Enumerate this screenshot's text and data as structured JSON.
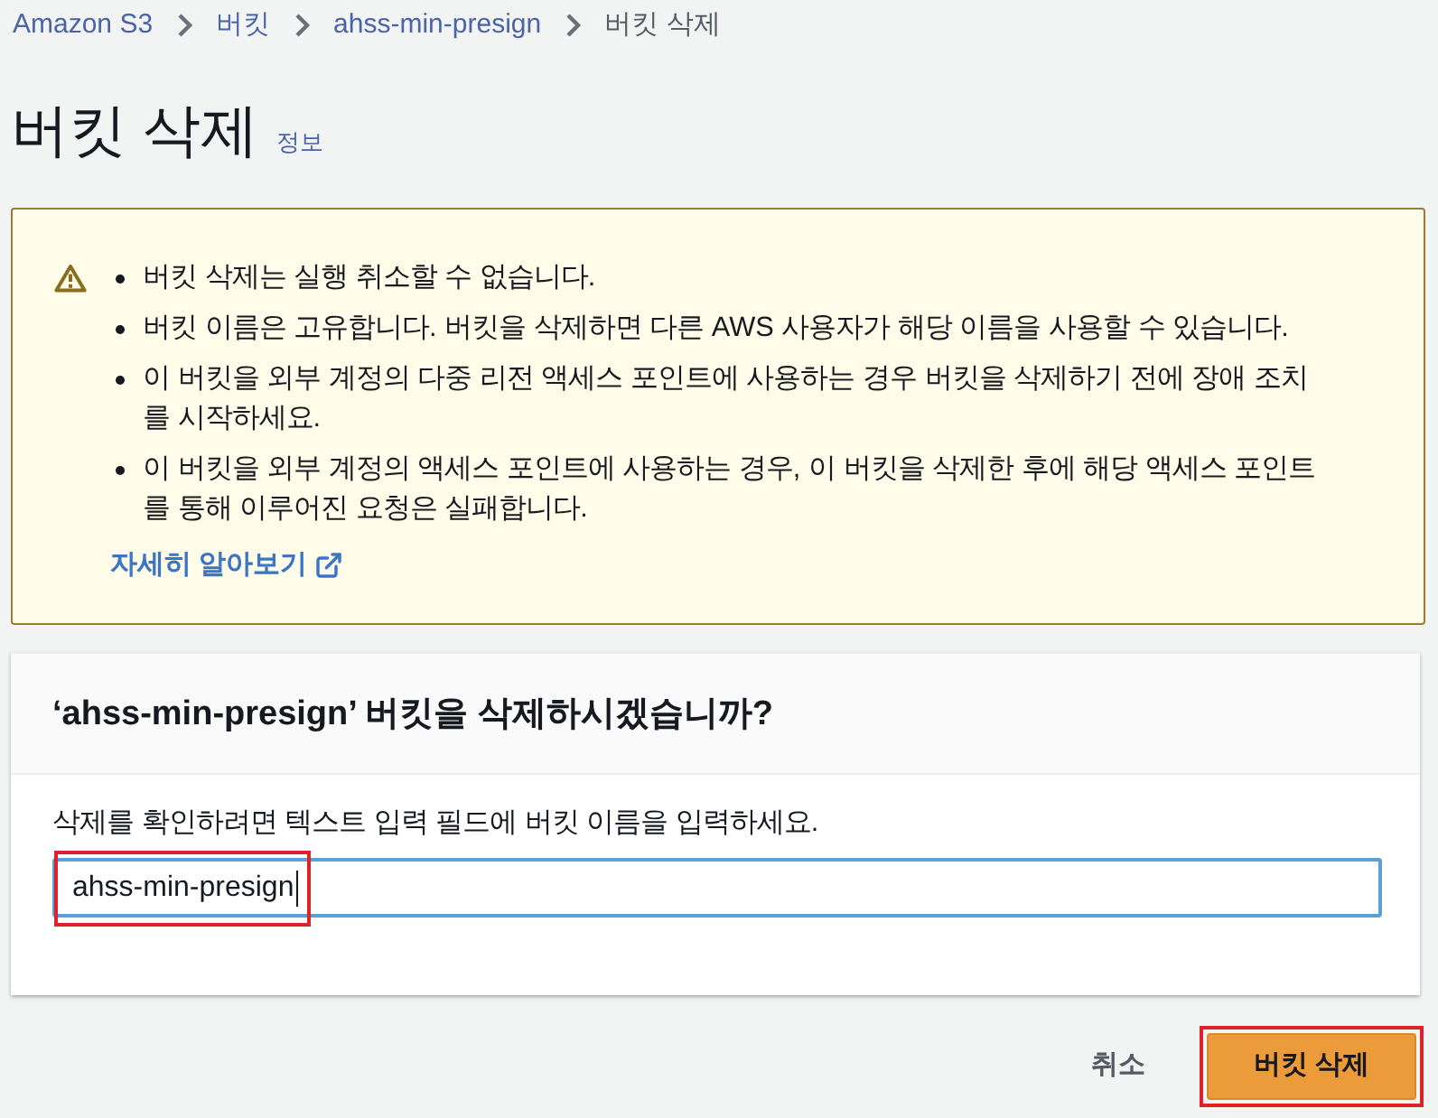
{
  "breadcrumb": [
    {
      "label": "Amazon S3",
      "kind": "link"
    },
    {
      "label": "버킷",
      "kind": "link"
    },
    {
      "label": "ahss-min-presign",
      "kind": "link"
    },
    {
      "label": "버킷 삭제",
      "kind": "current"
    }
  ],
  "page": {
    "title": "버킷 삭제",
    "info_link": "정보"
  },
  "alert": {
    "items": [
      "버킷 삭제는 실행 취소할 수 없습니다.",
      "버킷 이름은 고유합니다. 버킷을 삭제하면 다른 AWS 사용자가 해당 이름을 사용할 수 있습니다.",
      "이 버킷을 외부 계정의 다중 리전 액세스 포인트에 사용하는 경우 버킷을 삭제하기 전에 장애 조치를 시작하세요.",
      "이 버킷을 외부 계정의 액세스 포인트에 사용하는 경우, 이 버킷을 삭제한 후에 해당 액세스 포인트를 통해 이루어진 요청은 실패합니다."
    ],
    "learn_more": "자세히 알아보기"
  },
  "confirm": {
    "title": "‘ahss-min-presign’ 버킷을 삭제하시겠습니까?",
    "label": "삭제를 확인하려면 텍스트 입력 필드에 버킷 이름을 입력하세요.",
    "input": {
      "value": "ahss-min-presign",
      "focused": true,
      "highlighted": true
    }
  },
  "actions": {
    "cancel": "취소",
    "delete": {
      "label": "버킷 삭제",
      "highlighted": true
    }
  }
}
